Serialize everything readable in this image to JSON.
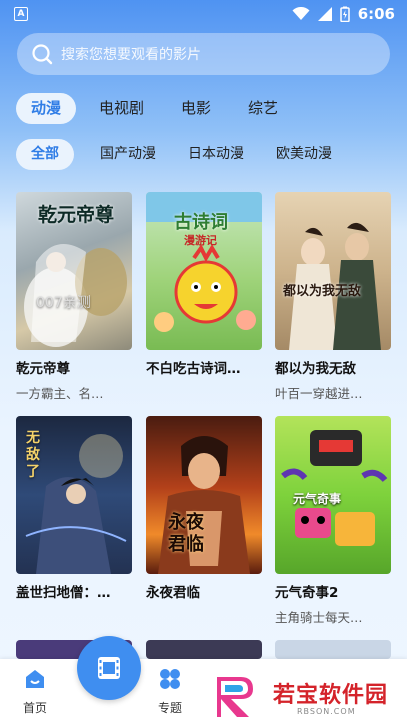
{
  "status_bar": {
    "app_badge": "A",
    "time": "6:06"
  },
  "search": {
    "placeholder": "搜索您想要观看的影片"
  },
  "category_tabs": [
    {
      "label": "动漫",
      "active": true
    },
    {
      "label": "电视剧",
      "active": false
    },
    {
      "label": "电影",
      "active": false
    },
    {
      "label": "综艺",
      "active": false
    }
  ],
  "filters": [
    {
      "label": "全部",
      "active": true
    },
    {
      "label": "国产动漫",
      "active": false
    },
    {
      "label": "日本动漫",
      "active": false
    },
    {
      "label": "欧美动漫",
      "active": false
    }
  ],
  "items": [
    {
      "title": "乾元帝尊",
      "desc": "一方霸主、名…",
      "poster_text": "乾元帝尊",
      "poster_sub": "007亲测"
    },
    {
      "title": "不白吃古诗词…",
      "desc": "",
      "poster_text": "古诗词",
      "poster_sub": "漫游记"
    },
    {
      "title": "都以为我无敌",
      "desc": "叶百一穿越进…",
      "poster_text": "都以为我无敌"
    },
    {
      "title": "盖世扫地僧：…",
      "desc": "",
      "poster_text": "无敌了"
    },
    {
      "title": "永夜君临",
      "desc": "",
      "poster_text": "永夜君临"
    },
    {
      "title": "元气奇事2",
      "desc": "主角骑士每天…",
      "poster_text": "元气奇事"
    }
  ],
  "bottom_nav": {
    "home": "首页",
    "topics": "专题"
  },
  "watermark": {
    "text": "若宝软件园",
    "sub": "RBSON.COM"
  },
  "colors": {
    "accent": "#2f7de6",
    "nav_center": "#3f8ef0"
  }
}
